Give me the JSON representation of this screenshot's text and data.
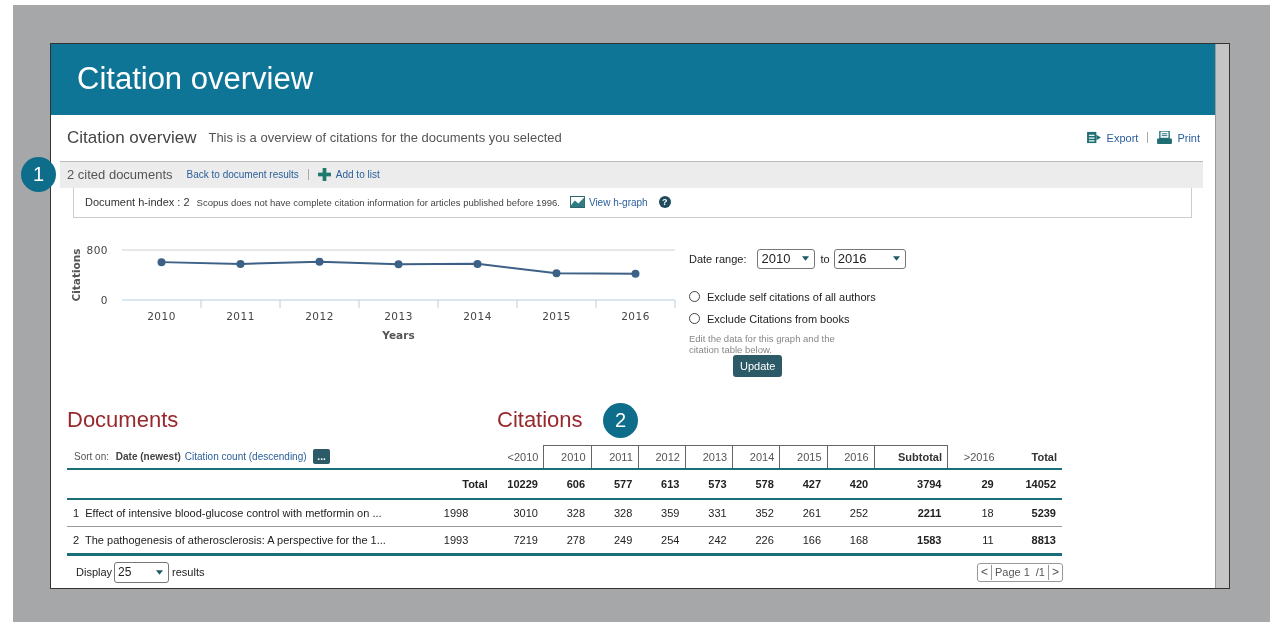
{
  "header": {
    "title": "Citation overview"
  },
  "page": {
    "title": "Citation overview",
    "subtitle": "This is a overview of citations for the documents you selected",
    "actions": [
      {
        "label": "Export",
        "kind": "export"
      },
      {
        "label": "Print",
        "kind": "print"
      }
    ]
  },
  "toolbar": {
    "count": "2 cited documents",
    "back_link": "Back to document results",
    "add_link": "Add to list"
  },
  "hindex": {
    "label": "Document h-index : 2",
    "note": "Scopus does not have complete citation information for articles published before 1996.",
    "link": "View h-graph",
    "help": "?"
  },
  "callouts": [
    {
      "label": "1"
    },
    {
      "label": "2"
    }
  ],
  "chart": {
    "chart_data": {
      "type": "line",
      "xlabel": "Years",
      "ylabel": "Citations",
      "categories": [
        "2010",
        "2011",
        "2012",
        "2013",
        "2014",
        "2015",
        "2016"
      ],
      "ylim": [
        0,
        800
      ],
      "yticks": [
        0,
        800
      ],
      "series": [
        {
          "color": "#3d6186",
          "marker": true,
          "values": [
            606,
            577,
            613,
            573,
            578,
            427,
            420
          ]
        }
      ]
    }
  },
  "controls": {
    "date_label": "Date range:",
    "from": "2010",
    "to_label": "to",
    "to": "2016",
    "checkboxes": [
      {
        "label": "Exclude self citations of all authors",
        "checked": false
      },
      {
        "label": "Exclude Citations from books",
        "checked": false
      }
    ],
    "note": "Edit the data for this graph and the citation table below.",
    "button": "Update"
  },
  "documents": {
    "heading": "Documents",
    "sort_label": "Sort on:",
    "sort_options": [
      {
        "label": "Date (newest)",
        "selected": true
      },
      {
        "label": "Citation count (descending)",
        "selected": false
      }
    ],
    "more": "..."
  },
  "citations": {
    "heading": "Citations"
  },
  "table": {
    "columns": [
      {
        "label": "<2010",
        "kind": "before"
      },
      {
        "label": "2010",
        "kind": "year"
      },
      {
        "label": "2011",
        "kind": "year"
      },
      {
        "label": "2012",
        "kind": "year"
      },
      {
        "label": "2013",
        "kind": "year"
      },
      {
        "label": "2014",
        "kind": "year"
      },
      {
        "label": "2015",
        "kind": "year"
      },
      {
        "label": "2016",
        "kind": "year"
      },
      {
        "label": "Subtotal",
        "kind": "subtotal"
      },
      {
        "label": ">2016",
        "kind": "after"
      },
      {
        "label": "Total",
        "kind": "total"
      }
    ],
    "total_row": {
      "label": "Total",
      "values": [
        "10229",
        "606",
        "577",
        "613",
        "573",
        "578",
        "427",
        "420",
        "3794",
        "29",
        "14052"
      ]
    },
    "rows": [
      {
        "index": "1",
        "title": "Effect of intensive blood-glucose control with metformin on ...",
        "year": "1998",
        "values": [
          "3010",
          "328",
          "328",
          "359",
          "331",
          "352",
          "261",
          "252",
          "2211",
          "18",
          "5239"
        ]
      },
      {
        "index": "2",
        "title": "The pathogenesis of atherosclerosis: A perspective for the 1...",
        "year": "1993",
        "values": [
          "7219",
          "278",
          "249",
          "254",
          "242",
          "226",
          "166",
          "168",
          "1583",
          "11",
          "8813"
        ]
      }
    ]
  },
  "pagination": {
    "display_label": "Display",
    "page_size": "25",
    "suffix": "results",
    "prev": "<",
    "page": "Page 1",
    "pages": "/1",
    "next": ">"
  }
}
